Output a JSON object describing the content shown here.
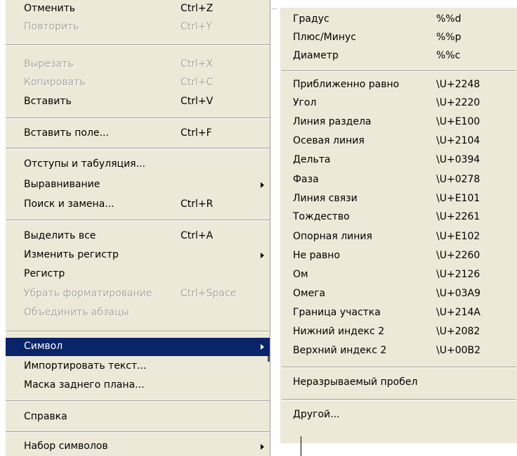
{
  "left_menu": {
    "items": [
      {
        "label": "Отменить",
        "shortcut": "Ctrl+Z",
        "disabled": false
      },
      {
        "label": "Повторить",
        "shortcut": "Ctrl+Y",
        "disabled": true
      },
      {
        "label": "Вырезать",
        "shortcut": "Ctrl+X",
        "disabled": true
      },
      {
        "label": "Копировать",
        "shortcut": "Ctrl+C",
        "disabled": true
      },
      {
        "label": "Вставить",
        "shortcut": "Ctrl+V",
        "disabled": false
      },
      {
        "label": "Вставить поле...",
        "shortcut": "Ctrl+F",
        "disabled": false
      },
      {
        "label": "Отступы и табуляция...",
        "shortcut": "",
        "disabled": false
      },
      {
        "label": "Выравнивание",
        "shortcut": "",
        "disabled": false,
        "submenu": true
      },
      {
        "label": "Поиск и замена...",
        "shortcut": "Ctrl+R",
        "disabled": false
      },
      {
        "label": "Выделить все",
        "shortcut": "Ctrl+A",
        "disabled": false
      },
      {
        "label": "Изменить регистр",
        "shortcut": "",
        "disabled": false,
        "submenu": true
      },
      {
        "label": "Регистр",
        "shortcut": "",
        "disabled": false
      },
      {
        "label": "Убрать форматирование",
        "shortcut": "Ctrl+Space",
        "disabled": true
      },
      {
        "label": "Объединить абзацы",
        "shortcut": "",
        "disabled": true
      },
      {
        "label": "Символ",
        "shortcut": "",
        "disabled": false,
        "submenu": true,
        "selected": true
      },
      {
        "label": "Импортировать текст...",
        "shortcut": "",
        "disabled": false
      },
      {
        "label": "Маска заднего плана...",
        "shortcut": "",
        "disabled": false
      },
      {
        "label": "Справка",
        "shortcut": "",
        "disabled": false
      },
      {
        "label": "Набор символов",
        "shortcut": "",
        "disabled": false,
        "submenu": true
      }
    ]
  },
  "right_menu": {
    "items": [
      {
        "label": "Градус",
        "code": "%%d"
      },
      {
        "label": "Плюс/Минус",
        "code": "%%p"
      },
      {
        "label": "Диаметр",
        "code": "%%c"
      },
      {
        "label": "Приближенно равно",
        "code": "\\U+2248"
      },
      {
        "label": "Угол",
        "code": "\\U+2220"
      },
      {
        "label": "Линия раздела",
        "code": "\\U+E100"
      },
      {
        "label": "Осевая линия",
        "code": "\\U+2104"
      },
      {
        "label": "Дельта",
        "code": "\\U+0394"
      },
      {
        "label": "Фаза",
        "code": "\\U+0278"
      },
      {
        "label": "Линия связи",
        "code": "\\U+E101"
      },
      {
        "label": "Тождество",
        "code": "\\U+2261"
      },
      {
        "label": "Опорная линия",
        "code": "\\U+E102"
      },
      {
        "label": "Не равно",
        "code": "\\U+2260"
      },
      {
        "label": "Ом",
        "code": "\\U+2126"
      },
      {
        "label": "Омега",
        "code": "\\U+03A9"
      },
      {
        "label": "Граница участка",
        "code": "\\U+214A"
      },
      {
        "label": "Нижний индекс 2",
        "code": "\\U+2082"
      },
      {
        "label": "Верхний индекс 2",
        "code": "\\U+00B2"
      },
      {
        "label": "Неразрываемый пробел",
        "code": ""
      },
      {
        "label": "Другой...",
        "code": ""
      }
    ]
  },
  "colors": {
    "menu_bg": "#ece9d8",
    "highlight": "#0a246a",
    "disabled_text": "#a9a89f"
  }
}
